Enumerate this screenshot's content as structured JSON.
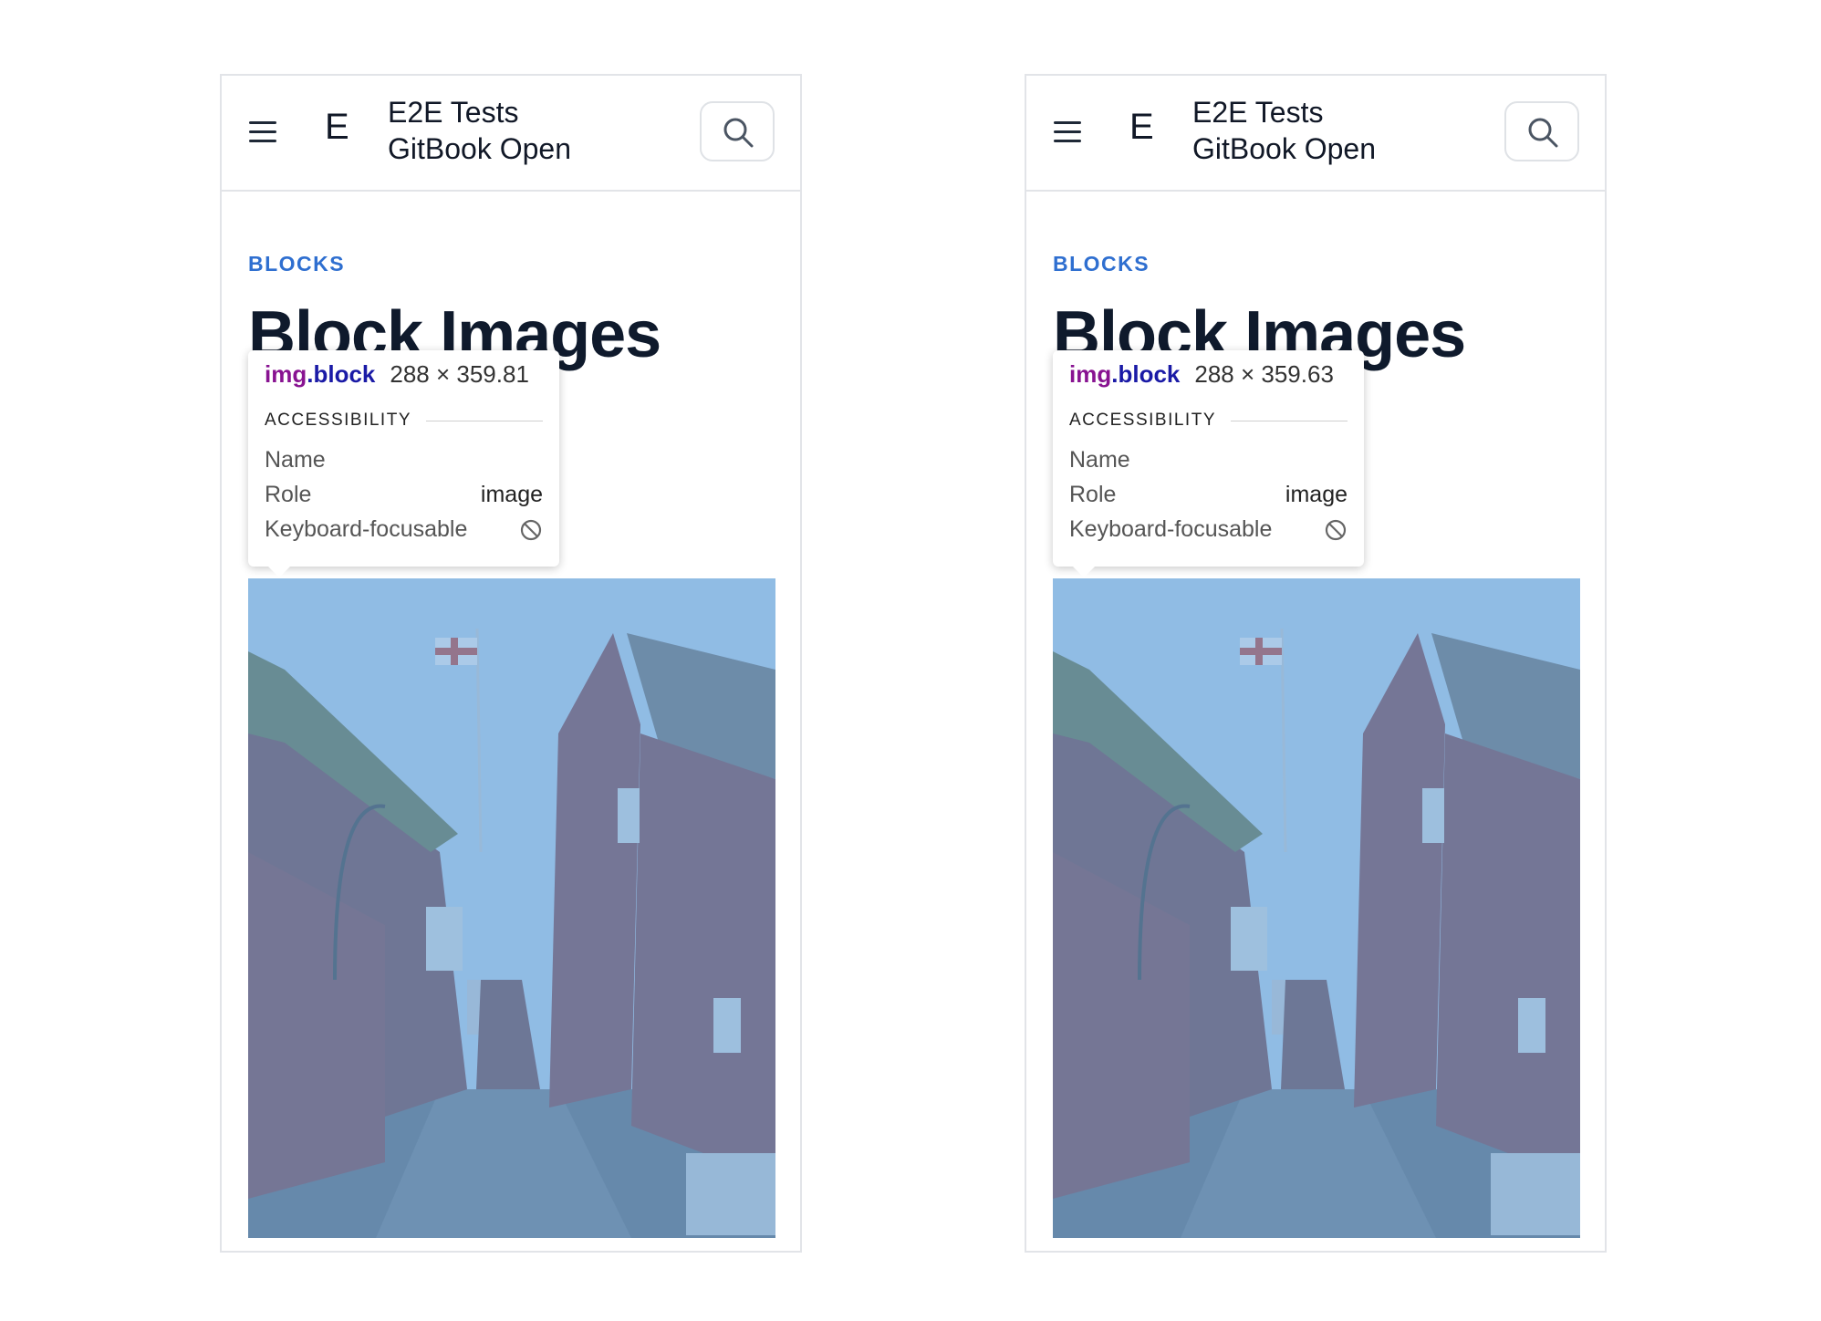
{
  "colors": {
    "accent": "#2f6fd0",
    "title": "#0f1a2c",
    "overlay": "#6fa8dc",
    "tag": "#881391",
    "class": "#1a1aa6"
  },
  "icons": {
    "menu": "hamburger-menu-icon",
    "search": "search-icon",
    "not_focusable": "not-allowed-icon"
  },
  "panels": [
    {
      "header": {
        "logo_letter": "E",
        "title_line1": "E2E Tests",
        "title_line2": "GitBook Open"
      },
      "breadcrumb": "BLOCKS",
      "page_title": "Block Images",
      "partial_text": "e",
      "tooltip": {
        "tag": "img",
        "class": ".block",
        "dimensions": "288 × 359.81",
        "section": "ACCESSIBILITY",
        "name_label": "Name",
        "role_label": "Role",
        "role_value": "image",
        "focus_label": "Keyboard-focusable"
      }
    },
    {
      "header": {
        "logo_letter": "E",
        "title_line1": "E2E Tests",
        "title_line2": "GitBook Open"
      },
      "breadcrumb": "BLOCKS",
      "page_title": "Block Images",
      "partial_text": "e",
      "tooltip": {
        "tag": "img",
        "class": ".block",
        "dimensions": "288 × 359.63",
        "section": "ACCESSIBILITY",
        "name_label": "Name",
        "role_label": "Role",
        "role_value": "image",
        "focus_label": "Keyboard-focusable"
      }
    }
  ]
}
